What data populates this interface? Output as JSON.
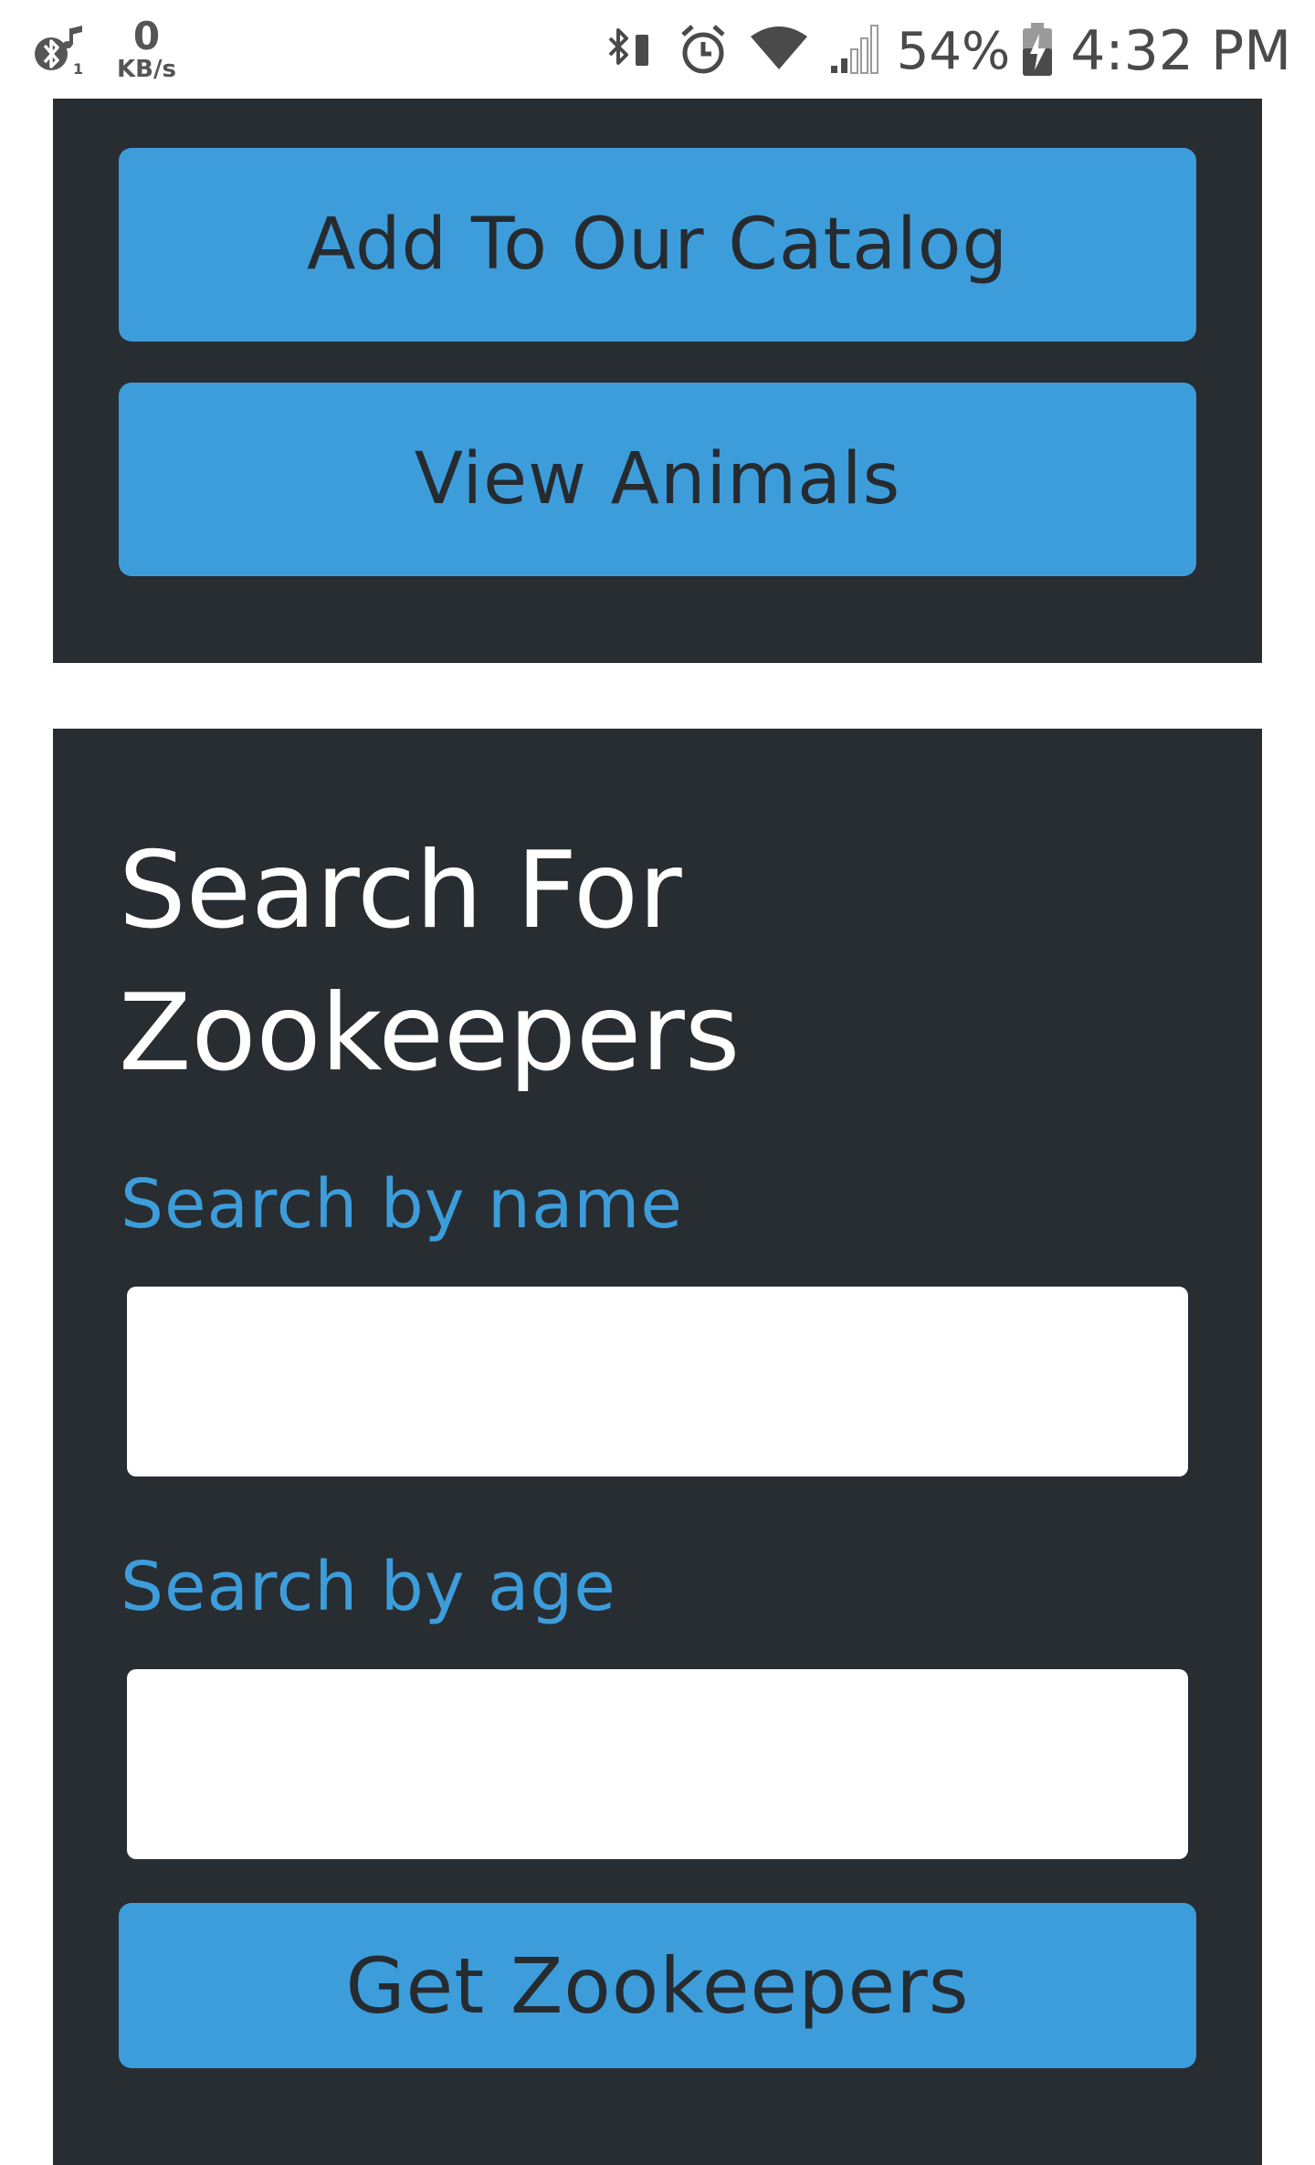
{
  "status_bar": {
    "left_icons": [
      "bluetooth-audio-icon"
    ],
    "network_speed_value": "0",
    "network_speed_unit": "KB/s",
    "right_icons": [
      "bluetooth-icon",
      "alarm-icon",
      "wifi-icon",
      "cellular-signal-icon",
      "battery-charging-icon"
    ],
    "battery_percent": "54%",
    "time": "4:32 PM"
  },
  "actions": {
    "add_label": "Add To Our Catalog",
    "view_label": "View Animals"
  },
  "search": {
    "title": "Search For Zookeepers",
    "name_label": "Search by name",
    "name_value": "",
    "age_label": "Search by age",
    "age_value": "",
    "submit_label": "Get Zookeepers"
  },
  "colors": {
    "card_background": "#282d32",
    "accent": "#3d9ddb",
    "button_text": "#262b30",
    "title_text": "#ffffff"
  }
}
